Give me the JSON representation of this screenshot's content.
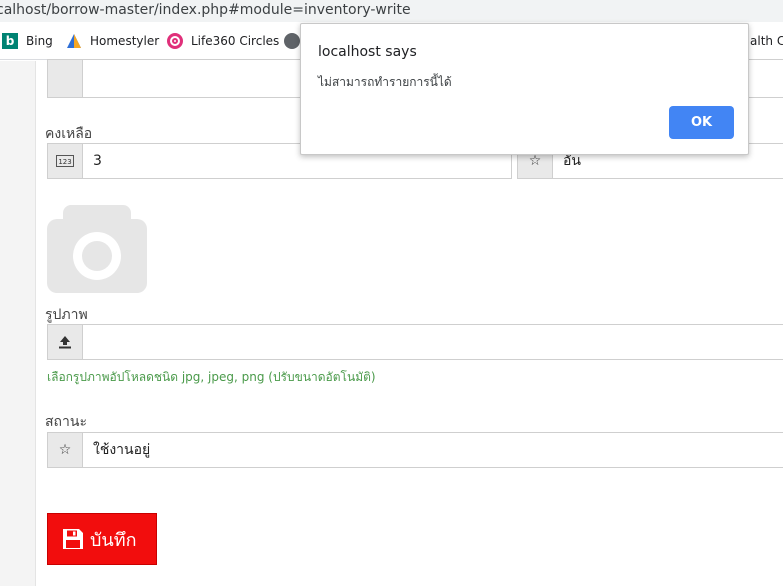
{
  "browser": {
    "url": "calhost/borrow-master/index.php#module=inventory-write",
    "bookmarks": [
      {
        "label": "Bing",
        "icon": "bing-icon"
      },
      {
        "label": "Homestyler",
        "icon": "homestyler-icon"
      },
      {
        "label": "Life360 Circles",
        "icon": "life360-icon"
      },
      {
        "label": "",
        "icon": "globe-icon"
      },
      {
        "label": "alth Ch",
        "icon": ""
      }
    ]
  },
  "form": {
    "remaining": {
      "label": "คงเหลือ",
      "value": "3",
      "icon": "number-icon"
    },
    "unit": {
      "value": "อัน",
      "icon": "star-icon"
    },
    "image": {
      "label": "รูปภาพ",
      "icon": "upload-icon",
      "hint": "เลือกรูปภาพอัปโหลดชนิด jpg, jpeg, png (ปรับขนาดอัตโนมัติ)"
    },
    "status": {
      "label": "สถานะ",
      "value": "ใช้งานอยู่",
      "icon": "star-icon"
    },
    "save_label": "บันทึก"
  },
  "dialog": {
    "title": "localhost says",
    "message": "ไม่สามารถทำรายการนี้ได้",
    "ok_label": "OK"
  },
  "colors": {
    "save_button": "#f20d0d",
    "ok_button": "#4285f4",
    "hint_text": "#4a9a4a"
  }
}
